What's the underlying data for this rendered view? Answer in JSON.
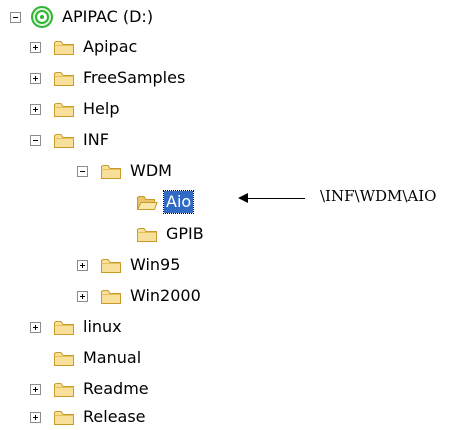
{
  "tree": {
    "root": {
      "label": "APIPAC (D:)",
      "icon": "drive-icon",
      "expanded": true
    },
    "items": [
      {
        "label": "Apipac",
        "expander": "plus"
      },
      {
        "label": "FreeSamples",
        "expander": "plus"
      },
      {
        "label": "Help",
        "expander": "plus"
      },
      {
        "label": "INF",
        "expander": "minus"
      },
      {
        "label": "WDM",
        "expander": "minus"
      },
      {
        "label": "Aio",
        "expander": "none",
        "selected": true,
        "open_folder": true
      },
      {
        "label": "GPIB",
        "expander": "none"
      },
      {
        "label": "Win95",
        "expander": "plus"
      },
      {
        "label": "Win2000",
        "expander": "plus"
      },
      {
        "label": "linux",
        "expander": "plus"
      },
      {
        "label": "Manual",
        "expander": "none"
      },
      {
        "label": "Readme",
        "expander": "plus"
      },
      {
        "label": "Release",
        "expander": "plus"
      }
    ]
  },
  "annotation": {
    "text": "\\INF\\WDM\\AIO"
  },
  "colors": {
    "folder_fill": "#f8e09a",
    "folder_stroke": "#c89a2a",
    "selection": "#316ac5",
    "drive_green": "#2fb52f"
  }
}
